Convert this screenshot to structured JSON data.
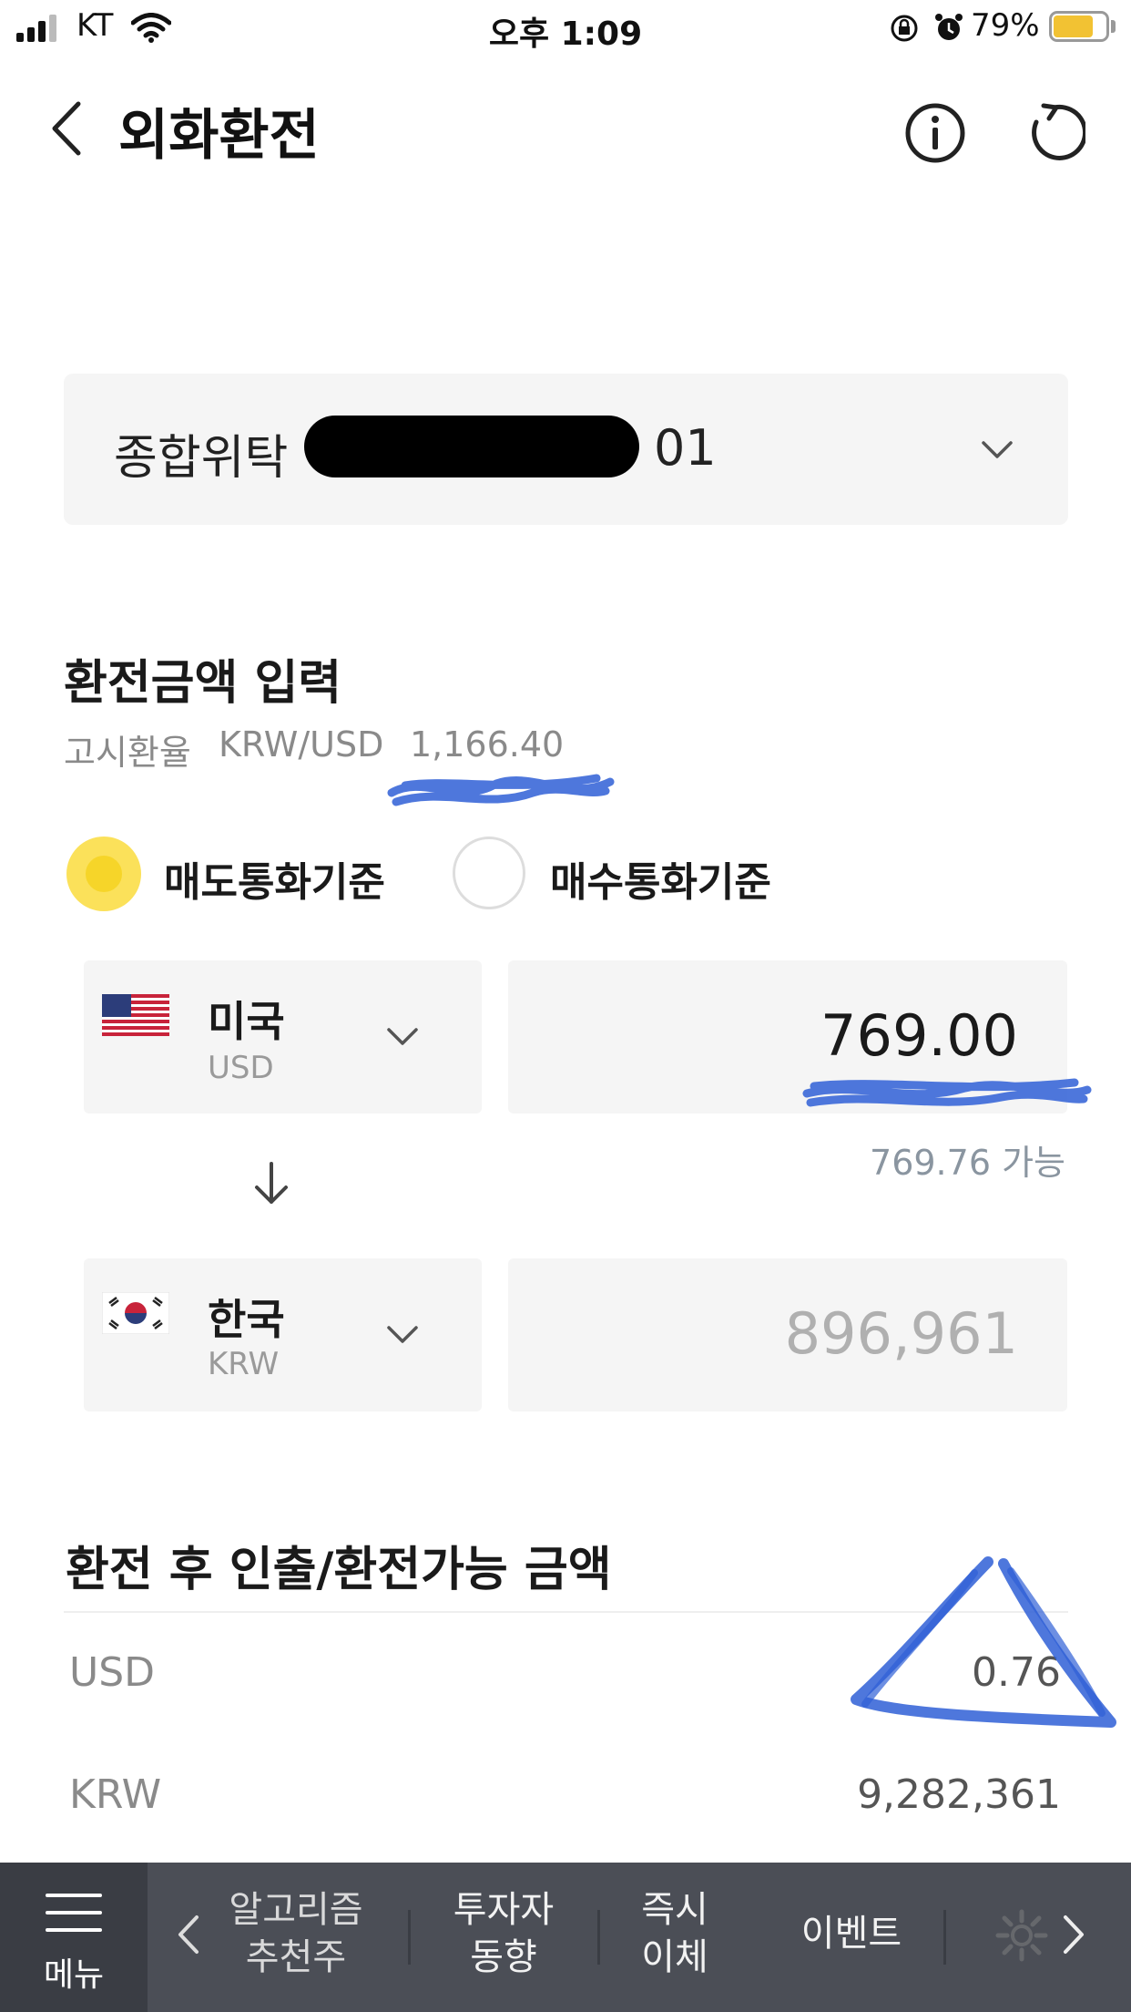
{
  "status_bar": {
    "carrier": "KT",
    "time": "오후 1:09",
    "battery_pct": "79%",
    "battery_level": 0.79
  },
  "header": {
    "title": "외화환전",
    "back_icon": "chevron-left-icon",
    "info_icon": "info-icon",
    "refresh_icon": "refresh-icon"
  },
  "account": {
    "type": "종합위탁",
    "number_suffix": "01"
  },
  "exchange_input": {
    "section_title": "환전금액 입력",
    "rate_label": "고시환율",
    "rate_pair": "KRW/USD",
    "rate_value": "1,166.40",
    "basis_options": [
      {
        "label": "매도통화기준",
        "selected": true
      },
      {
        "label": "매수통화기준",
        "selected": false
      }
    ],
    "from": {
      "country": "미국",
      "code": "USD",
      "amount": "769.00",
      "available": "769.76 가능"
    },
    "to": {
      "country": "한국",
      "code": "KRW",
      "amount": "896,961"
    }
  },
  "after_exchange": {
    "section_title": "환전 후 인출/환전가능 금액",
    "rows": [
      {
        "currency": "USD",
        "value": "0.76"
      },
      {
        "currency": "KRW",
        "value": "9,282,361"
      }
    ]
  },
  "bottom_nav": {
    "menu_label": "메뉴",
    "items": [
      {
        "line1": "알고리즘",
        "line2": "추천주"
      },
      {
        "line1": "투자자",
        "line2": "동향"
      },
      {
        "line1": "즉시",
        "line2": "이체"
      },
      {
        "line1": "이벤트",
        "line2": ""
      }
    ]
  },
  "colors": {
    "accent_yellow": "#f6d529",
    "nav_bg": "#4b4e56",
    "annotation_blue": "#2f5fd6"
  }
}
